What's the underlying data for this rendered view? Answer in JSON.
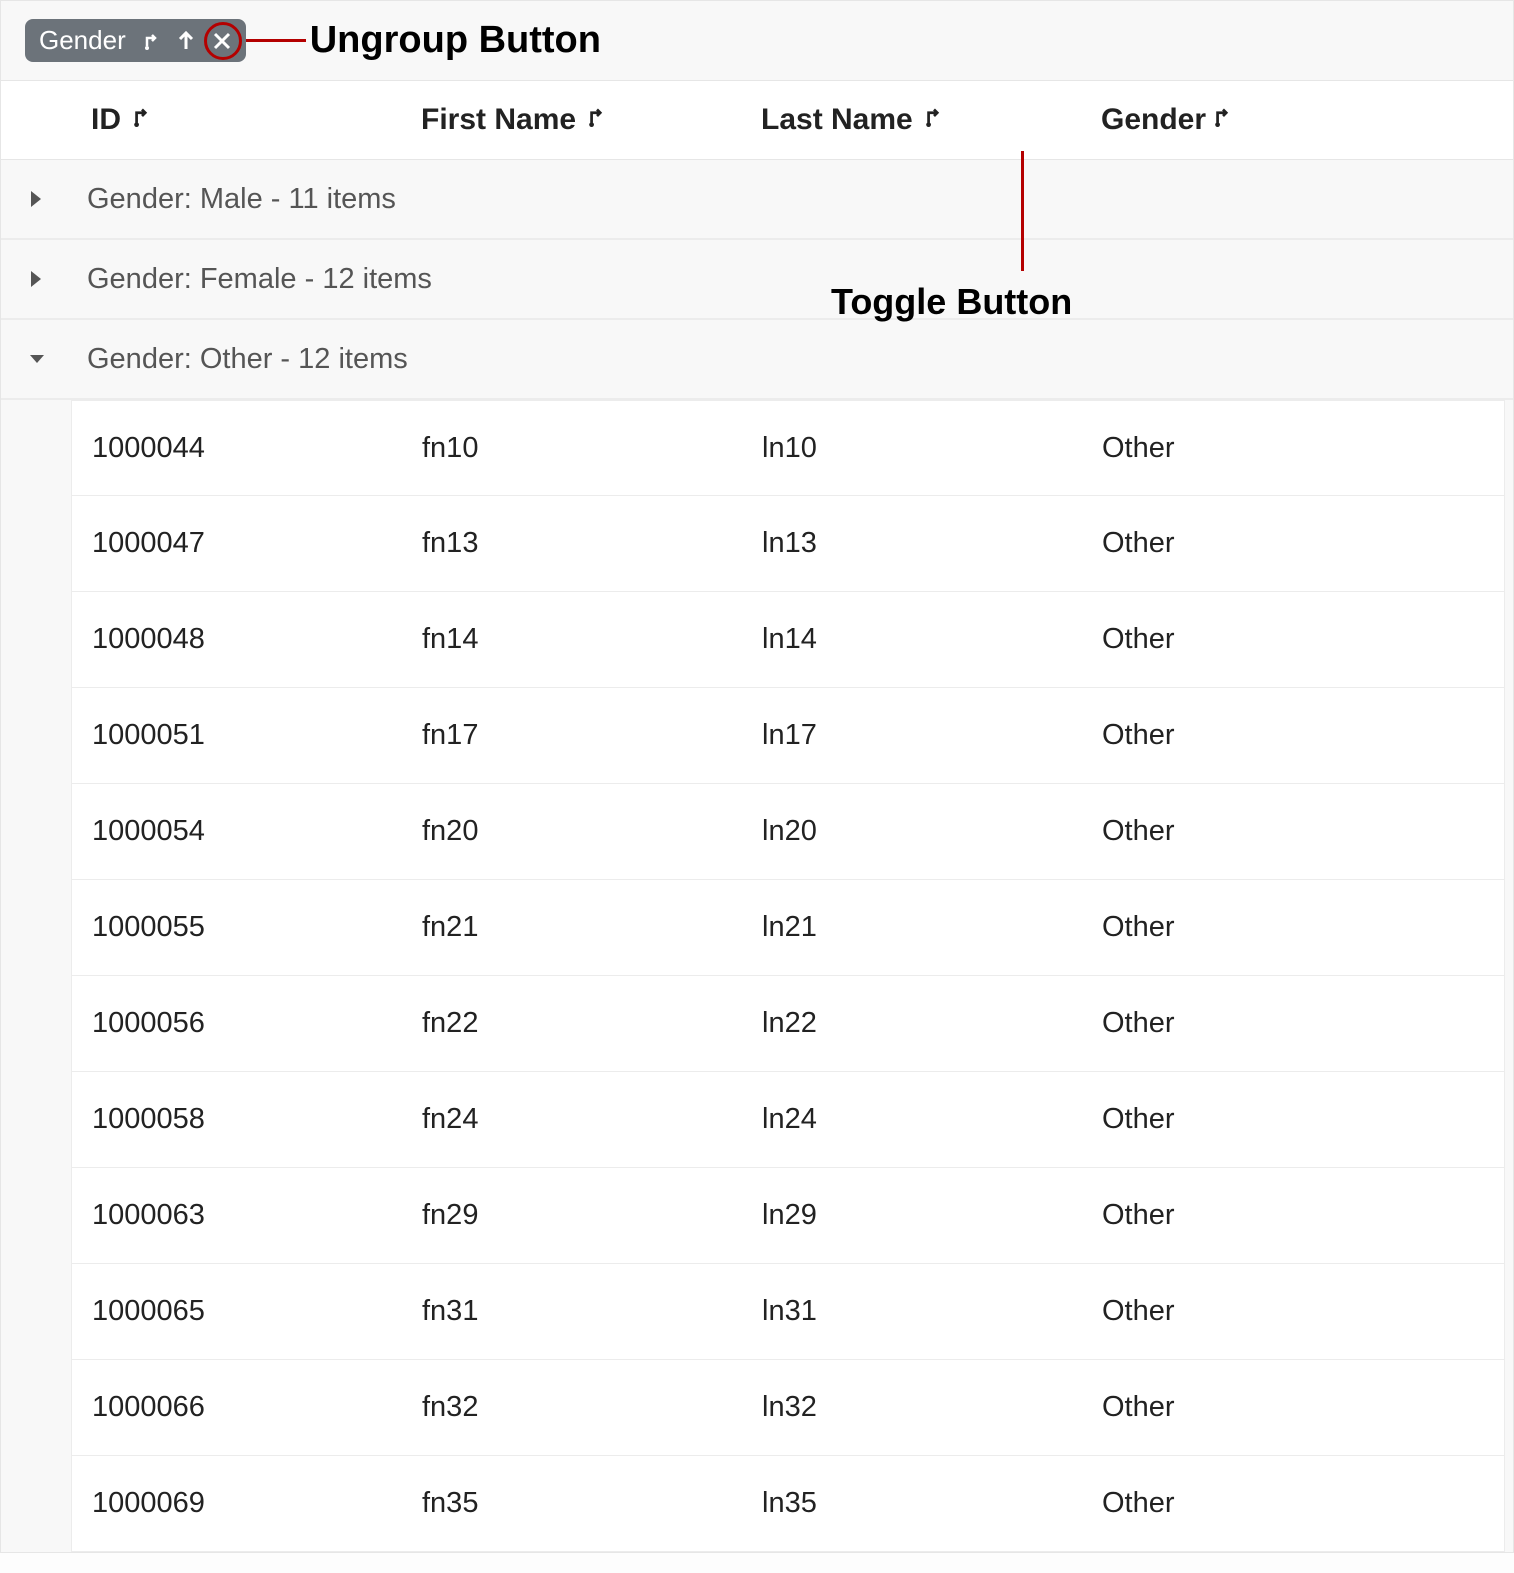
{
  "annotations": {
    "ungroup_button": "Ungroup Button",
    "toggle_button": "Toggle Button"
  },
  "group_chip": {
    "label": "Gender"
  },
  "columns": {
    "id": "ID",
    "first_name": "First Name",
    "last_name": "Last Name",
    "gender": "Gender"
  },
  "groups": [
    {
      "label": "Gender: Male - 11 items",
      "expanded": false
    },
    {
      "label": "Gender: Female - 12 items",
      "expanded": false
    },
    {
      "label": "Gender: Other - 12 items",
      "expanded": true
    }
  ],
  "rows": [
    {
      "id": "1000044",
      "first_name": "fn10",
      "last_name": "ln10",
      "gender": "Other"
    },
    {
      "id": "1000047",
      "first_name": "fn13",
      "last_name": "ln13",
      "gender": "Other"
    },
    {
      "id": "1000048",
      "first_name": "fn14",
      "last_name": "ln14",
      "gender": "Other"
    },
    {
      "id": "1000051",
      "first_name": "fn17",
      "last_name": "ln17",
      "gender": "Other"
    },
    {
      "id": "1000054",
      "first_name": "fn20",
      "last_name": "ln20",
      "gender": "Other"
    },
    {
      "id": "1000055",
      "first_name": "fn21",
      "last_name": "ln21",
      "gender": "Other"
    },
    {
      "id": "1000056",
      "first_name": "fn22",
      "last_name": "ln22",
      "gender": "Other"
    },
    {
      "id": "1000058",
      "first_name": "fn24",
      "last_name": "ln24",
      "gender": "Other"
    },
    {
      "id": "1000063",
      "first_name": "fn29",
      "last_name": "ln29",
      "gender": "Other"
    },
    {
      "id": "1000065",
      "first_name": "fn31",
      "last_name": "ln31",
      "gender": "Other"
    },
    {
      "id": "1000066",
      "first_name": "fn32",
      "last_name": "ln32",
      "gender": "Other"
    },
    {
      "id": "1000069",
      "first_name": "fn35",
      "last_name": "ln35",
      "gender": "Other"
    }
  ]
}
